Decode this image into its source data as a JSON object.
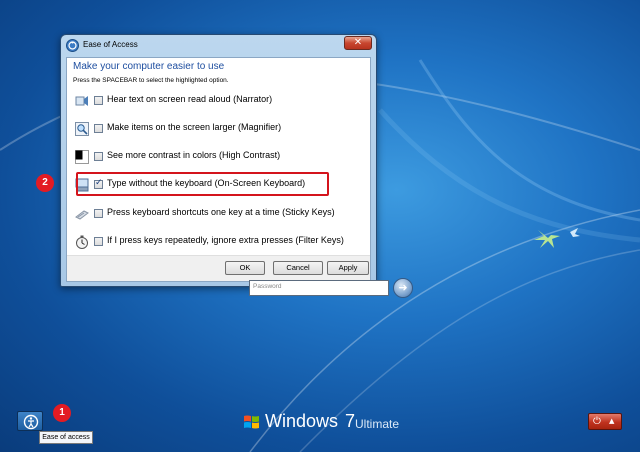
{
  "dialog": {
    "title": "Ease of Access",
    "close_label": "✕",
    "heading": "Make your computer easier to use",
    "subheading": "Press the SPACEBAR to select the highlighted option.",
    "options": [
      {
        "label": "Hear text on screen read aloud (Narrator)",
        "checked": false,
        "icon": "narrator-icon"
      },
      {
        "label": "Make items on the screen larger (Magnifier)",
        "checked": false,
        "icon": "magnifier-icon"
      },
      {
        "label": "See more contrast in colors (High Contrast)",
        "checked": false,
        "icon": "high-contrast-icon"
      },
      {
        "label": "Type without the keyboard (On-Screen Keyboard)",
        "checked": true,
        "icon": "keyboard-icon"
      },
      {
        "label": "Press keyboard shortcuts one key at a time (Sticky Keys)",
        "checked": false,
        "icon": "sticky-keys-icon"
      },
      {
        "label": "If I press keys repeatedly, ignore extra presses (Filter Keys)",
        "checked": false,
        "icon": "filter-keys-icon"
      }
    ],
    "buttons": {
      "ok": "OK",
      "cancel": "Cancel",
      "apply": "Apply"
    }
  },
  "login": {
    "password_placeholder": "Password",
    "go_label": "➜"
  },
  "markers": {
    "one": "1",
    "two": "2"
  },
  "bottom": {
    "ease_tooltip": "Ease of access",
    "brand_name": "Windows",
    "brand_version": "7",
    "brand_edition": "Ultimate",
    "power_label": "⏻",
    "power_arrow": "▲"
  },
  "colors": {
    "highlight": "#d4141c",
    "marker": "#e31b23",
    "heading": "#1f4fa0"
  }
}
